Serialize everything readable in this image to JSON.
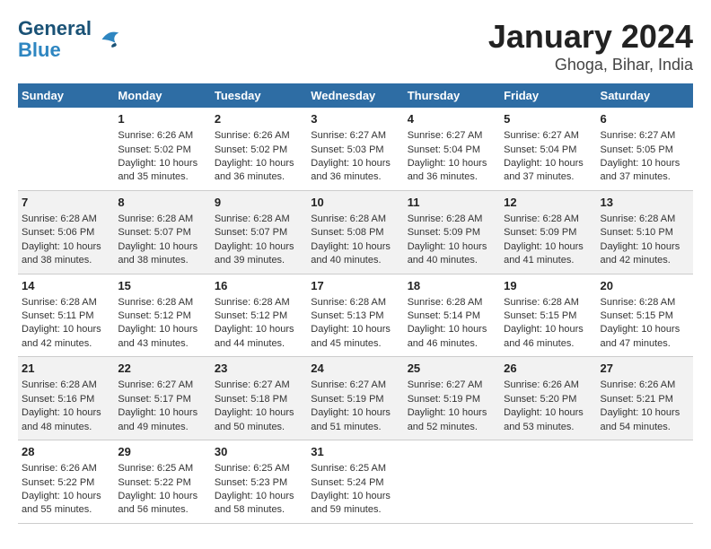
{
  "logo": {
    "line1": "General",
    "line2": "Blue"
  },
  "title": "January 2024",
  "subtitle": "Ghoga, Bihar, India",
  "days_header": [
    "Sunday",
    "Monday",
    "Tuesday",
    "Wednesday",
    "Thursday",
    "Friday",
    "Saturday"
  ],
  "weeks": [
    [
      {
        "num": "",
        "info": ""
      },
      {
        "num": "1",
        "info": "Sunrise: 6:26 AM\nSunset: 5:02 PM\nDaylight: 10 hours\nand 35 minutes."
      },
      {
        "num": "2",
        "info": "Sunrise: 6:26 AM\nSunset: 5:02 PM\nDaylight: 10 hours\nand 36 minutes."
      },
      {
        "num": "3",
        "info": "Sunrise: 6:27 AM\nSunset: 5:03 PM\nDaylight: 10 hours\nand 36 minutes."
      },
      {
        "num": "4",
        "info": "Sunrise: 6:27 AM\nSunset: 5:04 PM\nDaylight: 10 hours\nand 36 minutes."
      },
      {
        "num": "5",
        "info": "Sunrise: 6:27 AM\nSunset: 5:04 PM\nDaylight: 10 hours\nand 37 minutes."
      },
      {
        "num": "6",
        "info": "Sunrise: 6:27 AM\nSunset: 5:05 PM\nDaylight: 10 hours\nand 37 minutes."
      }
    ],
    [
      {
        "num": "7",
        "info": "Sunrise: 6:28 AM\nSunset: 5:06 PM\nDaylight: 10 hours\nand 38 minutes."
      },
      {
        "num": "8",
        "info": "Sunrise: 6:28 AM\nSunset: 5:07 PM\nDaylight: 10 hours\nand 38 minutes."
      },
      {
        "num": "9",
        "info": "Sunrise: 6:28 AM\nSunset: 5:07 PM\nDaylight: 10 hours\nand 39 minutes."
      },
      {
        "num": "10",
        "info": "Sunrise: 6:28 AM\nSunset: 5:08 PM\nDaylight: 10 hours\nand 40 minutes."
      },
      {
        "num": "11",
        "info": "Sunrise: 6:28 AM\nSunset: 5:09 PM\nDaylight: 10 hours\nand 40 minutes."
      },
      {
        "num": "12",
        "info": "Sunrise: 6:28 AM\nSunset: 5:09 PM\nDaylight: 10 hours\nand 41 minutes."
      },
      {
        "num": "13",
        "info": "Sunrise: 6:28 AM\nSunset: 5:10 PM\nDaylight: 10 hours\nand 42 minutes."
      }
    ],
    [
      {
        "num": "14",
        "info": "Sunrise: 6:28 AM\nSunset: 5:11 PM\nDaylight: 10 hours\nand 42 minutes."
      },
      {
        "num": "15",
        "info": "Sunrise: 6:28 AM\nSunset: 5:12 PM\nDaylight: 10 hours\nand 43 minutes."
      },
      {
        "num": "16",
        "info": "Sunrise: 6:28 AM\nSunset: 5:12 PM\nDaylight: 10 hours\nand 44 minutes."
      },
      {
        "num": "17",
        "info": "Sunrise: 6:28 AM\nSunset: 5:13 PM\nDaylight: 10 hours\nand 45 minutes."
      },
      {
        "num": "18",
        "info": "Sunrise: 6:28 AM\nSunset: 5:14 PM\nDaylight: 10 hours\nand 46 minutes."
      },
      {
        "num": "19",
        "info": "Sunrise: 6:28 AM\nSunset: 5:15 PM\nDaylight: 10 hours\nand 46 minutes."
      },
      {
        "num": "20",
        "info": "Sunrise: 6:28 AM\nSunset: 5:15 PM\nDaylight: 10 hours\nand 47 minutes."
      }
    ],
    [
      {
        "num": "21",
        "info": "Sunrise: 6:28 AM\nSunset: 5:16 PM\nDaylight: 10 hours\nand 48 minutes."
      },
      {
        "num": "22",
        "info": "Sunrise: 6:27 AM\nSunset: 5:17 PM\nDaylight: 10 hours\nand 49 minutes."
      },
      {
        "num": "23",
        "info": "Sunrise: 6:27 AM\nSunset: 5:18 PM\nDaylight: 10 hours\nand 50 minutes."
      },
      {
        "num": "24",
        "info": "Sunrise: 6:27 AM\nSunset: 5:19 PM\nDaylight: 10 hours\nand 51 minutes."
      },
      {
        "num": "25",
        "info": "Sunrise: 6:27 AM\nSunset: 5:19 PM\nDaylight: 10 hours\nand 52 minutes."
      },
      {
        "num": "26",
        "info": "Sunrise: 6:26 AM\nSunset: 5:20 PM\nDaylight: 10 hours\nand 53 minutes."
      },
      {
        "num": "27",
        "info": "Sunrise: 6:26 AM\nSunset: 5:21 PM\nDaylight: 10 hours\nand 54 minutes."
      }
    ],
    [
      {
        "num": "28",
        "info": "Sunrise: 6:26 AM\nSunset: 5:22 PM\nDaylight: 10 hours\nand 55 minutes."
      },
      {
        "num": "29",
        "info": "Sunrise: 6:25 AM\nSunset: 5:22 PM\nDaylight: 10 hours\nand 56 minutes."
      },
      {
        "num": "30",
        "info": "Sunrise: 6:25 AM\nSunset: 5:23 PM\nDaylight: 10 hours\nand 58 minutes."
      },
      {
        "num": "31",
        "info": "Sunrise: 6:25 AM\nSunset: 5:24 PM\nDaylight: 10 hours\nand 59 minutes."
      },
      {
        "num": "",
        "info": ""
      },
      {
        "num": "",
        "info": ""
      },
      {
        "num": "",
        "info": ""
      }
    ]
  ]
}
